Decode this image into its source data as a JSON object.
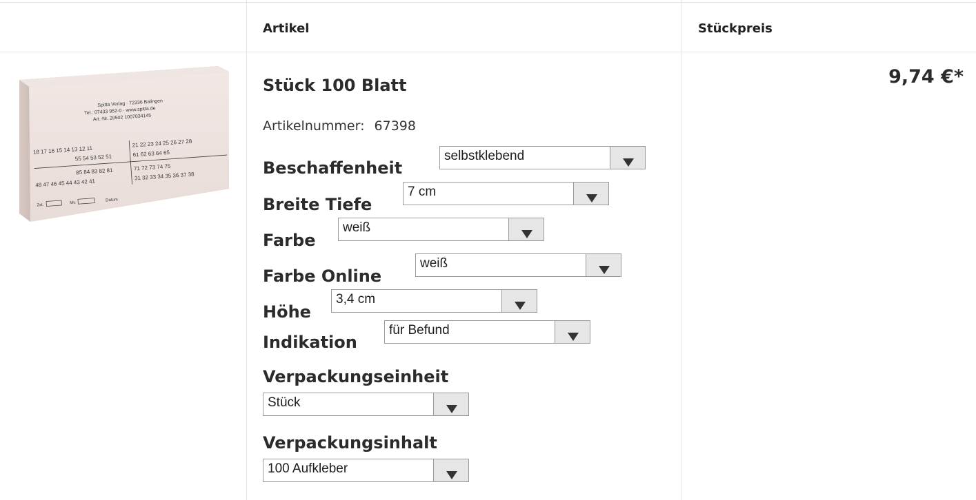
{
  "header": {
    "article_label": "Artikel",
    "unit_price_label": "Stückpreis"
  },
  "product": {
    "image": {
      "line1": "Spitta Verlag · 72336 Balingen",
      "line2": "Tel.: 07433 952-0 · www.spitta.de",
      "line3": "Art.-Nr. 20502  1007034145",
      "row_a_left": "18 17 16 15 14 13 12 11",
      "row_a_right": "21 22 23 24 25 26 27 28",
      "row_b_left": "55 54 53 52 51",
      "row_b_right": "61 62 63 64 65",
      "row_c_left": "85 84 83 82 81",
      "row_c_right": "71 72 73 74 75",
      "row_d_left": "48 47 46 45 44 43 42 41",
      "row_d_right": "31 32 33 34 35 36 37 38",
      "foot_zst": "Zst.",
      "foot_mu": "Mu",
      "foot_datum": "Datum"
    },
    "title": "Stück 100 Blatt",
    "article_number_label": "Artikelnummer:",
    "article_number": "67398",
    "price": "9,74 €*"
  },
  "options": [
    {
      "label": "Beschaffenheit",
      "value": "selbstklebend"
    },
    {
      "label": "Breite Tiefe",
      "value": "7 cm"
    },
    {
      "label": "Farbe",
      "value": "weiß"
    },
    {
      "label": "Farbe Online",
      "value": "weiß"
    },
    {
      "label": "Höhe",
      "value": "3,4 cm"
    },
    {
      "label": "Indikation",
      "value": "für Befund"
    },
    {
      "label": "Verpackungseinheit",
      "value": "Stück"
    },
    {
      "label": "Verpackungsinhalt",
      "value": "100 Aufkleber"
    }
  ]
}
